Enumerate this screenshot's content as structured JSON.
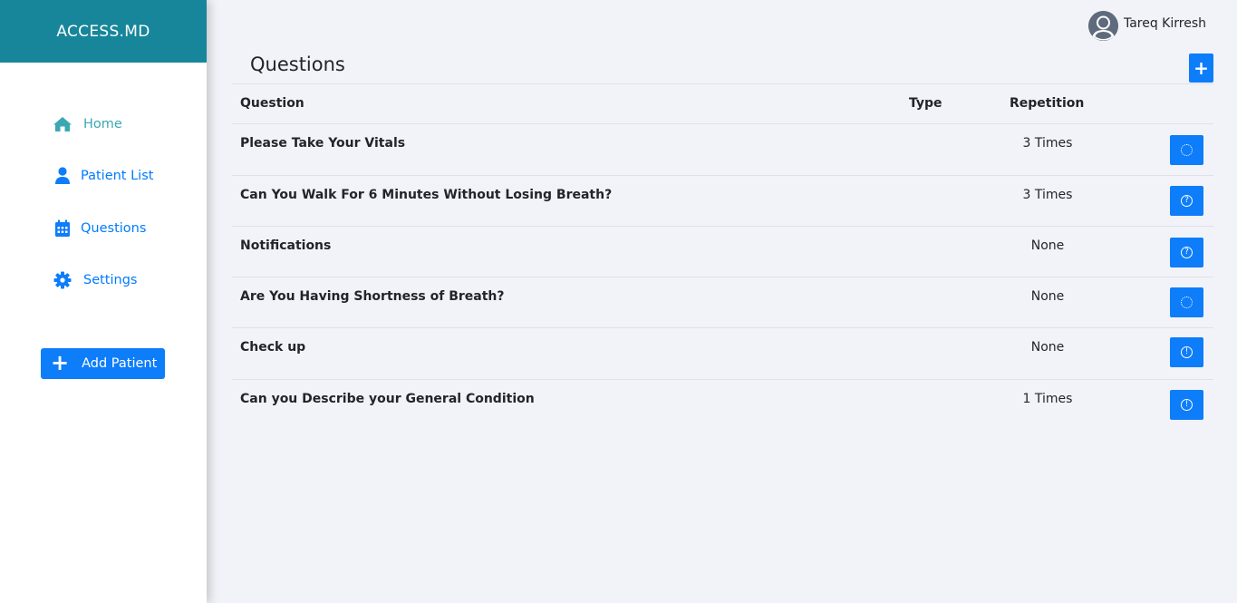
{
  "brand": "ACCESS.MD",
  "user": {
    "name": "Tareq Kirresh"
  },
  "nav": [
    {
      "label": "Home",
      "icon": "home-icon",
      "active": true
    },
    {
      "label": "Patient List",
      "icon": "user-icon",
      "active": false
    },
    {
      "label": "Questions",
      "icon": "calendar-icon",
      "active": false
    },
    {
      "label": "Settings",
      "icon": "gear-icon",
      "active": false
    }
  ],
  "add_patient_label": "Add Patient",
  "page_title": "Questions",
  "add_question_label": "+",
  "table": {
    "headers": {
      "question": "Question",
      "type": "Type",
      "repetition": "Repetition"
    },
    "rows": [
      {
        "question": "Please Take Your Vitals",
        "type": "",
        "repetition": "3 Times",
        "action_icon": "loading-circle-icon",
        "glyph": ""
      },
      {
        "question": "Can You Walk For 6 Minutes Without Losing Breath?",
        "type": "",
        "repetition": "3 Times",
        "action_icon": "question-circle-icon",
        "glyph": "?"
      },
      {
        "question": "Notifications",
        "type": "",
        "repetition": "None",
        "action_icon": "question-circle-icon",
        "glyph": "?"
      },
      {
        "question": "Are You Having Shortness of Breath?",
        "type": "",
        "repetition": "None",
        "action_icon": "loading-circle-icon",
        "glyph": ""
      },
      {
        "question": "Check up",
        "type": "",
        "repetition": "None",
        "action_icon": "exclamation-circle-icon",
        "glyph": "!"
      },
      {
        "question": "Can you Describe your General Condition",
        "type": "",
        "repetition": "1 Times",
        "action_icon": "exclamation-circle-icon",
        "glyph": "!"
      }
    ]
  },
  "colors": {
    "brand_bar": "#17869a",
    "primary": "#0d7dfa",
    "active_nav": "#3aa8b3",
    "background": "#f2f3f8"
  }
}
